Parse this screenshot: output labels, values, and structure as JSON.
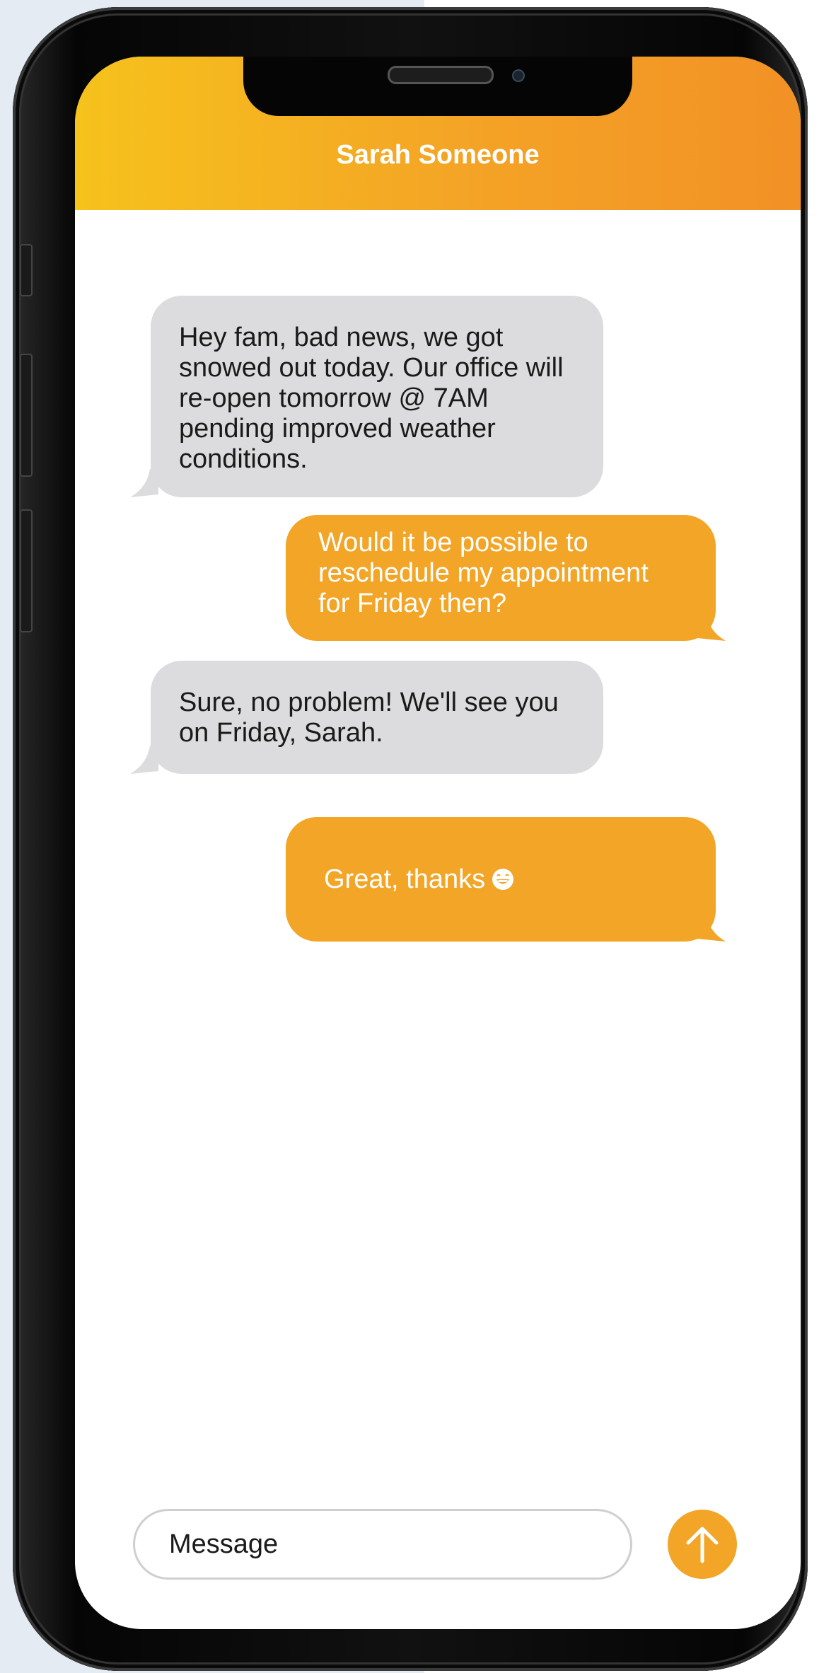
{
  "conversation": {
    "contact_name": "Sarah Someone",
    "messages": [
      {
        "direction": "received",
        "text": "Hey fam, bad news, we got snowed out today. Our office will re-open tomorrow @ 7AM pending improved weather conditions."
      },
      {
        "direction": "sent",
        "text": "Would it be possible to reschedule my appointment for Friday then?"
      },
      {
        "direction": "received",
        "text": "Sure, no problem! We'll see you on Friday, Sarah."
      },
      {
        "direction": "sent",
        "text": "Great, thanks",
        "emoji": "grinning-face-icon"
      }
    ]
  },
  "composer": {
    "placeholder": "Message",
    "send_icon": "arrow-up-icon"
  },
  "colors": {
    "accent": "#f2a526",
    "header_start": "#f6c21c",
    "header_end": "#f29126",
    "received_bubble": "#dcdcde",
    "background": "#e4ebf3"
  }
}
